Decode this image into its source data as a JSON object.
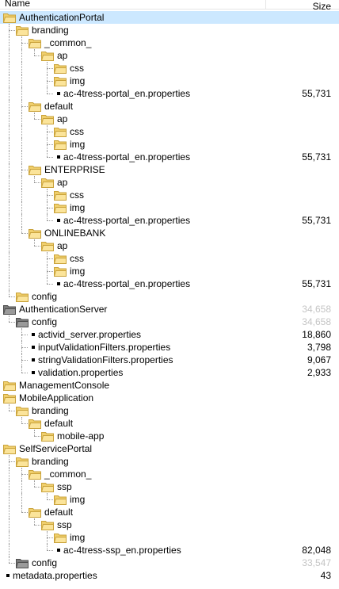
{
  "header": {
    "name_col": "Name",
    "size_col": "Size"
  },
  "colors": {
    "selection": "#cce8ff",
    "folder_yellow": "#f0cf6c",
    "folder_gray": "#7a7a7a",
    "muted_size": "#c4c4c4"
  },
  "tree": [
    {
      "label": "AuthenticationPortal",
      "level": 0,
      "type": "folder",
      "selected": true
    },
    {
      "label": "branding",
      "level": 1,
      "type": "folder"
    },
    {
      "label": "_common_",
      "level": 2,
      "type": "folder"
    },
    {
      "label": "ap",
      "level": 3,
      "type": "folder"
    },
    {
      "label": "css",
      "level": 4,
      "type": "folder"
    },
    {
      "label": "img",
      "level": 4,
      "type": "folder"
    },
    {
      "label": "ac-4tress-portal_en.properties",
      "level": 4,
      "type": "file",
      "size": "55,731"
    },
    {
      "label": "default",
      "level": 2,
      "type": "folder"
    },
    {
      "label": "ap",
      "level": 3,
      "type": "folder"
    },
    {
      "label": "css",
      "level": 4,
      "type": "folder"
    },
    {
      "label": "img",
      "level": 4,
      "type": "folder"
    },
    {
      "label": "ac-4tress-portal_en.properties",
      "level": 4,
      "type": "file",
      "size": "55,731"
    },
    {
      "label": "ENTERPRISE",
      "level": 2,
      "type": "folder"
    },
    {
      "label": "ap",
      "level": 3,
      "type": "folder"
    },
    {
      "label": "css",
      "level": 4,
      "type": "folder"
    },
    {
      "label": "img",
      "level": 4,
      "type": "folder"
    },
    {
      "label": "ac-4tress-portal_en.properties",
      "level": 4,
      "type": "file",
      "size": "55,731"
    },
    {
      "label": "ONLINEBANK",
      "level": 2,
      "type": "folder"
    },
    {
      "label": "ap",
      "level": 3,
      "type": "folder"
    },
    {
      "label": "css",
      "level": 4,
      "type": "folder"
    },
    {
      "label": "img",
      "level": 4,
      "type": "folder"
    },
    {
      "label": "ac-4tress-portal_en.properties",
      "level": 4,
      "type": "file",
      "size": "55,731"
    },
    {
      "label": "config",
      "level": 1,
      "type": "folder"
    },
    {
      "label": "AuthenticationServer",
      "level": 0,
      "type": "folder",
      "gray": true,
      "size": "34,658",
      "muted": true
    },
    {
      "label": "config",
      "level": 1,
      "type": "folder",
      "gray": true,
      "size": "34,658",
      "muted": true
    },
    {
      "label": "activid_server.properties",
      "level": 2,
      "type": "file",
      "size": "18,860"
    },
    {
      "label": "inputValidationFilters.properties",
      "level": 2,
      "type": "file",
      "size": "3,798"
    },
    {
      "label": "stringValidationFilters.properties",
      "level": 2,
      "type": "file",
      "size": "9,067"
    },
    {
      "label": "validation.properties",
      "level": 2,
      "type": "file",
      "size": "2,933"
    },
    {
      "label": "ManagementConsole",
      "level": 0,
      "type": "folder"
    },
    {
      "label": "MobileApplication",
      "level": 0,
      "type": "folder"
    },
    {
      "label": "branding",
      "level": 1,
      "type": "folder"
    },
    {
      "label": "default",
      "level": 2,
      "type": "folder"
    },
    {
      "label": "mobile-app",
      "level": 3,
      "type": "folder"
    },
    {
      "label": "SelfServicePortal",
      "level": 0,
      "type": "folder"
    },
    {
      "label": "branding",
      "level": 1,
      "type": "folder"
    },
    {
      "label": "_common_",
      "level": 2,
      "type": "folder"
    },
    {
      "label": "ssp",
      "level": 3,
      "type": "folder"
    },
    {
      "label": "img",
      "level": 4,
      "type": "folder"
    },
    {
      "label": "default",
      "level": 2,
      "type": "folder"
    },
    {
      "label": "ssp",
      "level": 3,
      "type": "folder"
    },
    {
      "label": "img",
      "level": 4,
      "type": "folder"
    },
    {
      "label": "ac-4tress-ssp_en.properties",
      "level": 4,
      "type": "file",
      "size": "82,048"
    },
    {
      "label": "config",
      "level": 1,
      "type": "folder",
      "gray": true,
      "size": "33,547",
      "muted": true
    },
    {
      "label": "metadata.properties",
      "level": 0,
      "type": "file",
      "size": "43"
    }
  ]
}
